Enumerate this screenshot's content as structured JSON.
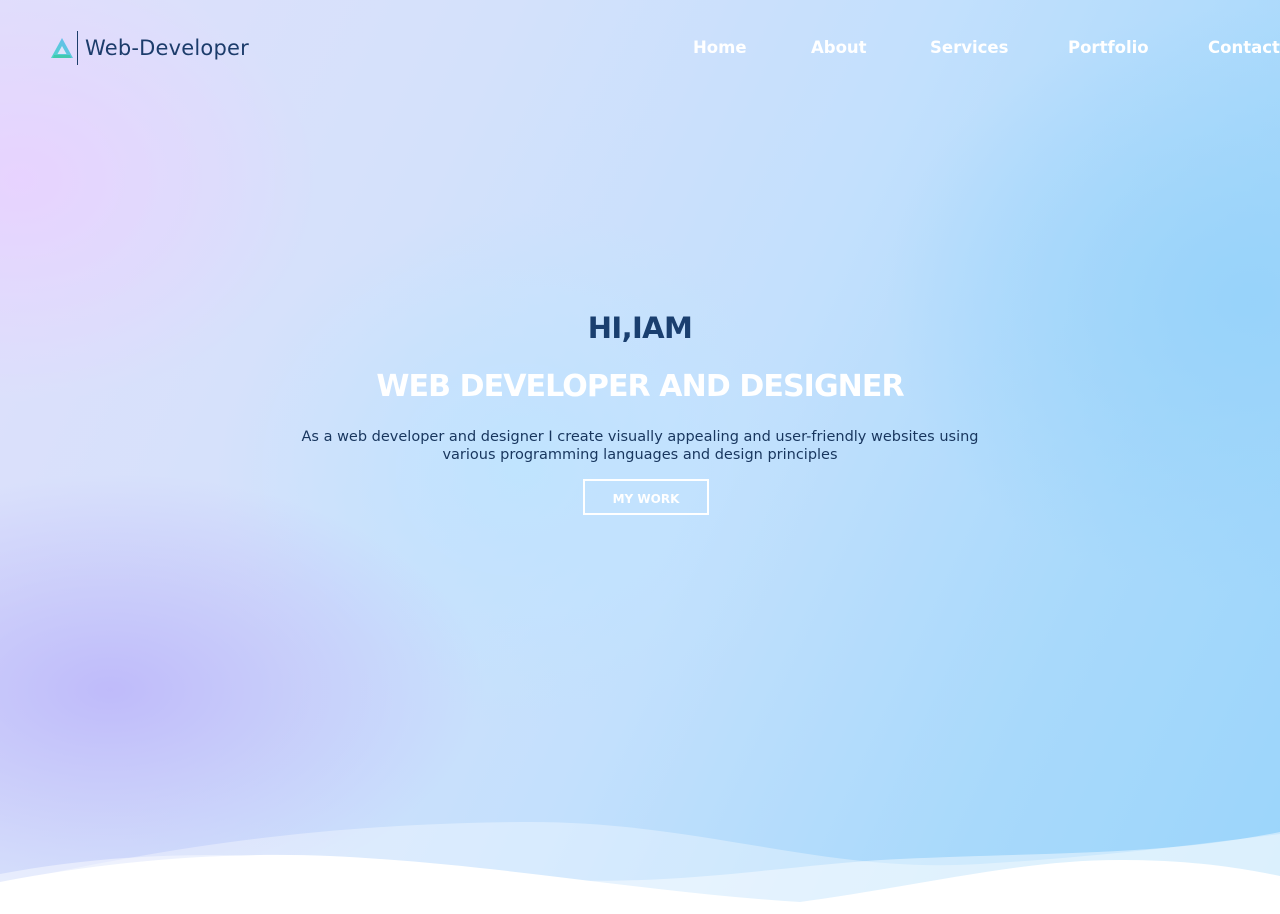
{
  "brand": {
    "name": "Web-Developer",
    "logo_icon": "triangle-logo-icon",
    "colors": {
      "brand_text": "#1c3c6b",
      "logo_gradient_start": "#4fd6c8",
      "logo_gradient_end": "#6ab8f5"
    }
  },
  "nav": {
    "items": [
      {
        "label": "Home"
      },
      {
        "label": "About"
      },
      {
        "label": "Services"
      },
      {
        "label": "Portfolio"
      },
      {
        "label": "Contact"
      }
    ]
  },
  "hero": {
    "greeting": "HI,IAM",
    "title": "WEB DEVELOPER AND DESIGNER",
    "description": "As a web developer and designer I create visually appealing and user-friendly websites using various programming languages and design principles",
    "button_label": "MY WORK",
    "colors": {
      "greeting": "#1a3f6f",
      "title": "#ffffff",
      "description": "#18365e",
      "button_border": "#ffffff"
    }
  }
}
